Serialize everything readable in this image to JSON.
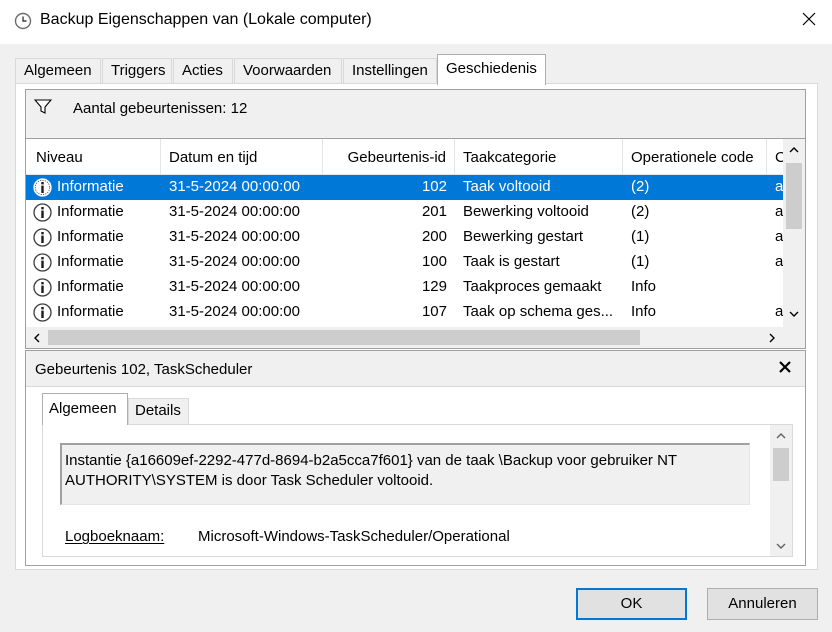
{
  "window": {
    "title": "Backup Eigenschappen van (Lokale computer)"
  },
  "tabs": [
    "Algemeen",
    "Triggers",
    "Acties",
    "Voorwaarden",
    "Instellingen",
    "Geschiedenis"
  ],
  "history": {
    "event_count_label": "Aantal gebeurtenissen: 12",
    "columns": [
      "Niveau",
      "Datum en tijd",
      "Gebeurtenis-id",
      "Taakcategorie",
      "Operationele code",
      "C"
    ],
    "rows": [
      {
        "level": "Informatie",
        "datetime": "31-5-2024 00:00:00",
        "id": "102",
        "category": "Taak voltooid",
        "opcode": "(2)",
        "extra": "a"
      },
      {
        "level": "Informatie",
        "datetime": "31-5-2024 00:00:00",
        "id": "201",
        "category": "Bewerking voltooid",
        "opcode": "(2)",
        "extra": "a"
      },
      {
        "level": "Informatie",
        "datetime": "31-5-2024 00:00:00",
        "id": "200",
        "category": "Bewerking gestart",
        "opcode": "(1)",
        "extra": "a"
      },
      {
        "level": "Informatie",
        "datetime": "31-5-2024 00:00:00",
        "id": "100",
        "category": "Taak is gestart",
        "opcode": "(1)",
        "extra": "a"
      },
      {
        "level": "Informatie",
        "datetime": "31-5-2024 00:00:00",
        "id": "129",
        "category": "Taakproces gemaakt",
        "opcode": "Info",
        "extra": ""
      },
      {
        "level": "Informatie",
        "datetime": "31-5-2024 00:00:00",
        "id": "107",
        "category": "Taak op schema ges...",
        "opcode": "Info",
        "extra": "a"
      }
    ],
    "selected_row": 0
  },
  "detail": {
    "title": "Gebeurtenis 102, TaskScheduler",
    "tabs": [
      "Algemeen",
      "Details"
    ],
    "description": "Instantie {a16609ef-2292-477d-8694-b2a5cca7f601} van de taak \\Backup voor gebruiker NT AUTHORITY\\SYSTEM is door Task Scheduler voltooid.",
    "log_label": "Logboeknaam:",
    "log_value": "Microsoft-Windows-TaskScheduler/Operational"
  },
  "buttons": {
    "ok": "OK",
    "cancel": "Annuleren"
  },
  "colors": {
    "accent": "#0078d7",
    "dialog_bg": "#f0f0f0",
    "border": "#a0a0a0"
  },
  "icons": {
    "title": "clock-icon",
    "close": "close-icon",
    "filter": "filter-icon",
    "level": "info-icon"
  }
}
